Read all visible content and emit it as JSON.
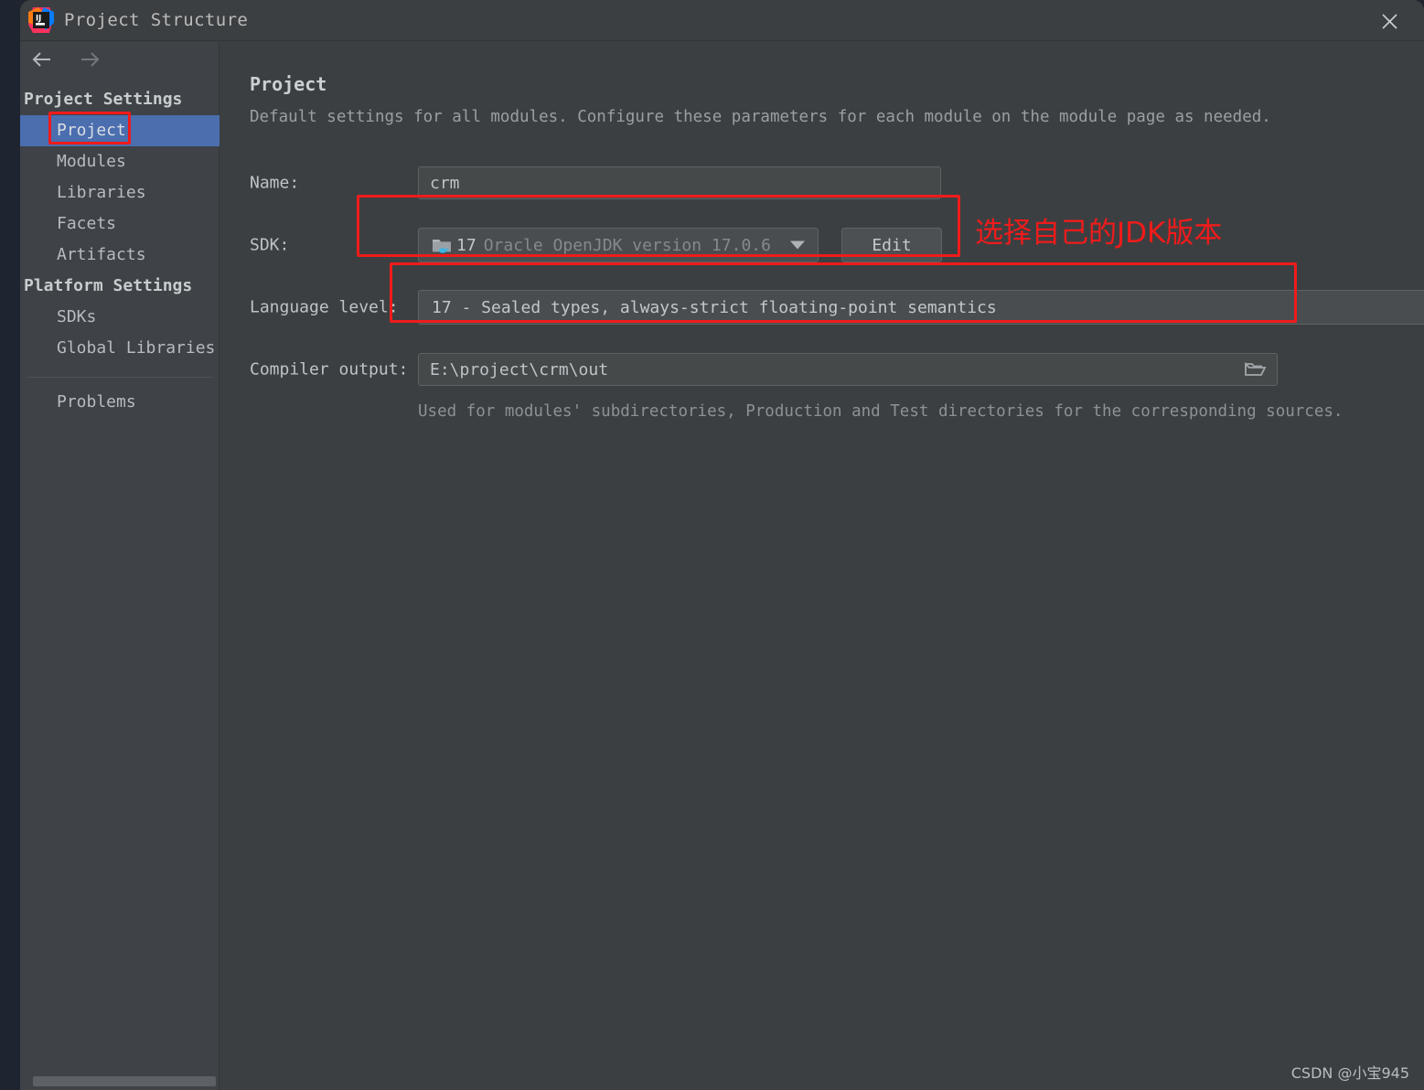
{
  "window": {
    "title": "Project Structure",
    "logo_icon": "intellij-idea-logo",
    "close_icon": "close-icon"
  },
  "nav": {
    "back_icon": "arrow-left-icon",
    "forward_icon": "arrow-right-icon"
  },
  "sidebar": {
    "groups": [
      {
        "label": "Project Settings",
        "items": [
          {
            "label": "Project",
            "selected": true
          },
          {
            "label": "Modules",
            "selected": false
          },
          {
            "label": "Libraries",
            "selected": false
          },
          {
            "label": "Facets",
            "selected": false
          },
          {
            "label": "Artifacts",
            "selected": false
          }
        ]
      },
      {
        "label": "Platform Settings",
        "items": [
          {
            "label": "SDKs",
            "selected": false
          },
          {
            "label": "Global Libraries",
            "selected": false
          }
        ]
      }
    ],
    "problems_label": "Problems"
  },
  "main": {
    "title": "Project",
    "description": "Default settings for all modules. Configure these parameters for each module on the module page as needed.",
    "fields": {
      "name": {
        "label": "Name:",
        "value": "crm"
      },
      "sdk": {
        "label": "SDK:",
        "version": "17",
        "description": "Oracle OpenJDK version 17.0.6",
        "icon": "jdk-folder-icon",
        "dropdown_icon": "chevron-down-icon",
        "edit_button": "Edit"
      },
      "language_level": {
        "label": "Language level:",
        "value": "17 - Sealed types, always-strict floating-point semantics",
        "dropdown_icon": "chevron-down-icon"
      },
      "compiler_output": {
        "label": "Compiler output:",
        "value": "E:\\project\\crm\\out",
        "browse_icon": "folder-icon",
        "helper": "Used for modules' subdirectories, Production and Test directories for the corresponding sources."
      }
    }
  },
  "annotations": {
    "jdk_note": "选择自己的JDK版本",
    "accent_color": "#f01b1b"
  },
  "watermark": "CSDN @小宝945"
}
